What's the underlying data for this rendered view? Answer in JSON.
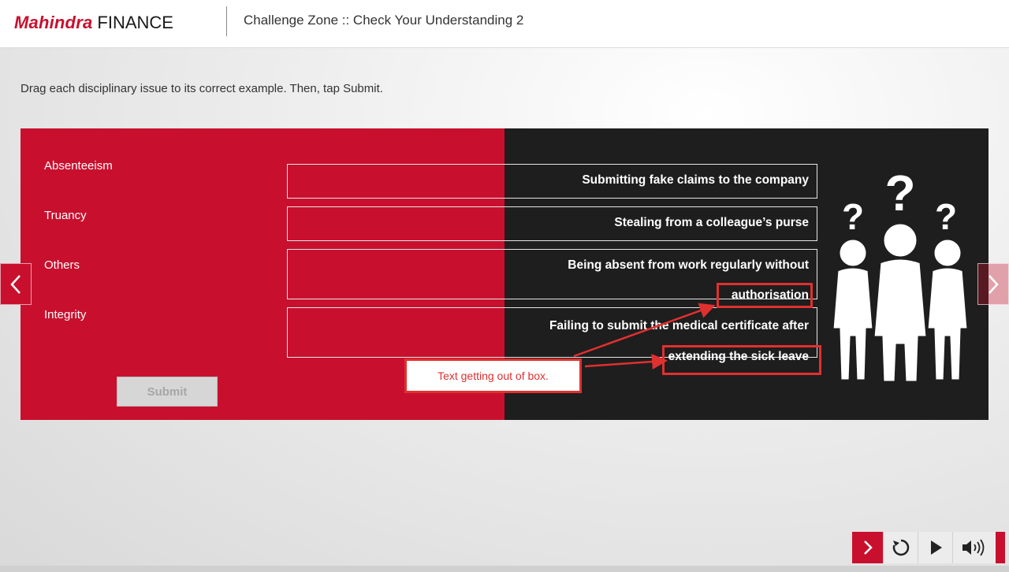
{
  "header": {
    "logo_brand": "Mahindra",
    "logo_suffix": "FINANCE",
    "course_title": "Challenge Zone :: Check Your Understanding 2"
  },
  "instruction": "Drag each disciplinary issue to its correct example. Then, tap Submit.",
  "issues": [
    "Absenteeism",
    "Truancy",
    "Others",
    "Integrity"
  ],
  "examples": {
    "e1": "Submitting fake claims to the company",
    "e2": "Stealing from a colleague’s purse",
    "e3_line1": "Being absent from work regularly without",
    "e3_line2": "authorisation",
    "e4_line1": "Failing to submit the medical certificate after",
    "e4_line2": "extending the sick leave"
  },
  "submit_label": "Submit",
  "annotation": {
    "callout_text": "Text getting out of box."
  },
  "icons": {
    "prev": "chevron-left-icon",
    "next": "chevron-right-icon",
    "illustration": "question-people-icon",
    "controls": [
      "next-icon",
      "replay-icon",
      "play-icon",
      "volume-icon"
    ]
  },
  "colors": {
    "brand_red": "#c8102e",
    "dark_panel": "#1e1e1e",
    "annotation_red": "#e03030"
  }
}
